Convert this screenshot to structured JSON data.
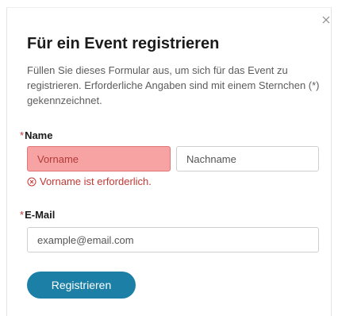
{
  "dialog": {
    "title": "Für ein Event registrieren",
    "description": "Füllen Sie dieses Formular aus, um sich für das Event zu registrieren. Erforderliche Angaben sind mit einem Sternchen (*) gekennzeichnet.",
    "close_icon": "close-icon"
  },
  "form": {
    "required_marker": "*",
    "name": {
      "label": "Name",
      "first_placeholder": "Vorname",
      "last_placeholder": "Nachname",
      "error": "Vorname ist erforderlich.",
      "error_icon": "error-circle-x-icon"
    },
    "email": {
      "label": "E-Mail",
      "placeholder": "example@email.com"
    },
    "submit_label": "Registrieren"
  },
  "colors": {
    "accent": "#1b7fa6",
    "error": "#c23934",
    "error_field_bg": "#f7a3a3"
  }
}
